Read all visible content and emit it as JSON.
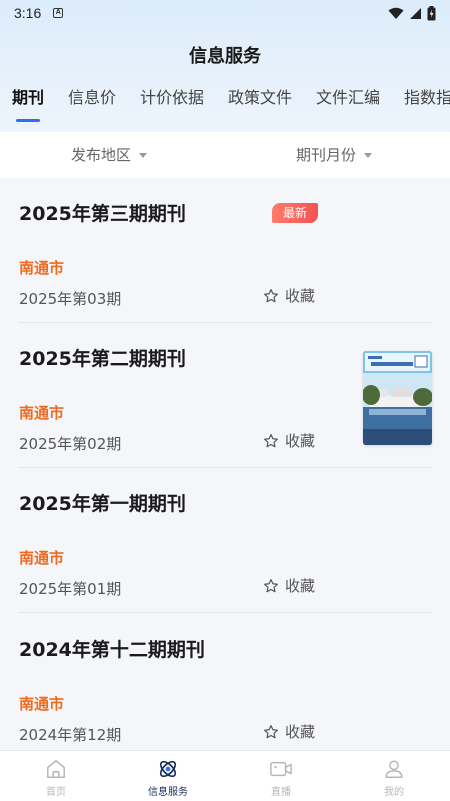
{
  "status": {
    "time": "3:16",
    "notification_icon": "A"
  },
  "header": {
    "title": "信息服务"
  },
  "tabs": [
    {
      "label": "期刊",
      "active": true
    },
    {
      "label": "信息价",
      "active": false
    },
    {
      "label": "计价依据",
      "active": false
    },
    {
      "label": "政策文件",
      "active": false
    },
    {
      "label": "文件汇编",
      "active": false
    },
    {
      "label": "指数指",
      "active": false
    }
  ],
  "filters": {
    "region_label": "发布地区",
    "month_label": "期刊月份"
  },
  "list": {
    "items": [
      {
        "title": "2025年第三期期刊",
        "city": "南通市",
        "issue": "2025年第03期",
        "favorite_label": "收藏",
        "badge": "最新",
        "has_cover": false
      },
      {
        "title": "2025年第二期期刊",
        "city": "南通市",
        "issue": "2025年第02期",
        "favorite_label": "收藏",
        "has_cover": true
      },
      {
        "title": "2025年第一期期刊",
        "city": "南通市",
        "issue": "2025年第01期",
        "favorite_label": "收藏",
        "has_cover": false
      },
      {
        "title": "2024年第十二期期刊",
        "city": "南通市",
        "issue": "2024年第12期",
        "favorite_label": "收藏",
        "has_cover": false
      }
    ]
  },
  "bottom_nav": [
    {
      "label": "首页",
      "icon": "home-icon",
      "active": false
    },
    {
      "label": "信息服务",
      "icon": "info-service-icon",
      "active": true
    },
    {
      "label": "直播",
      "icon": "live-video-icon",
      "active": false
    },
    {
      "label": "我的",
      "icon": "profile-icon",
      "active": false
    }
  ],
  "colors": {
    "accent": "#2f6ff0",
    "city": "#f06a1e",
    "badge": "#f35353",
    "nav_active": "#1a2e5a"
  }
}
